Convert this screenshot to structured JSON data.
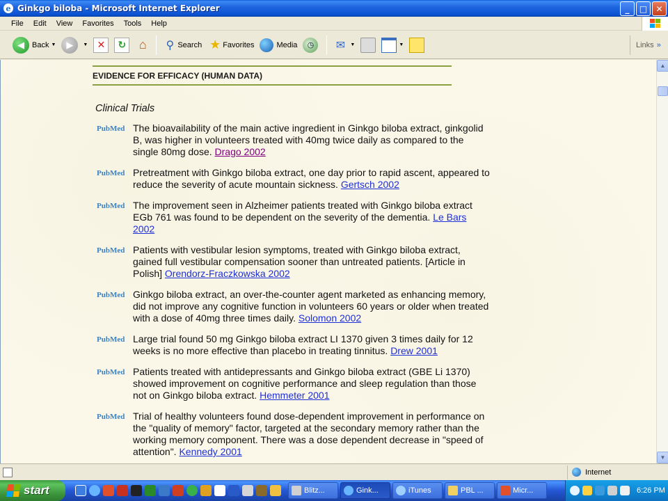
{
  "window": {
    "title": "Ginkgo biloba - Microsoft Internet Explorer",
    "buttons": {
      "minimize": "_",
      "maximize": "□",
      "close": "✕"
    }
  },
  "menu": [
    "File",
    "Edit",
    "View",
    "Favorites",
    "Tools",
    "Help"
  ],
  "toolbar": {
    "back_label": "Back",
    "search_label": "Search",
    "favorites_label": "Favorites",
    "media_label": "Media",
    "links_label": "Links"
  },
  "page": {
    "heading": "EVIDENCE FOR EFFICACY (HUMAN DATA)",
    "subheading": "Clinical Trials",
    "badge": "PubMed",
    "entries": [
      {
        "text": "The bioavailability of the main active ingredient in Ginkgo biloba extract, ginkgolid B, was higher in volunteers treated with 40mg twice daily as compared to the single 80mg dose. ",
        "link": "Drago 2002"
      },
      {
        "text": "Pretreatment with Ginkgo biloba extract, one day prior to rapid ascent, appeared to reduce the severity of acute mountain sickness. ",
        "link": "Gertsch 2002"
      },
      {
        "text": "The improvement seen in Alzheimer patients treated with Ginkgo biloba extract EGb 761 was found to be dependent on the severity of the dementia. ",
        "link": "Le Bars 2002"
      },
      {
        "text": "Patients with vestibular lesion symptoms, treated with Ginkgo biloba extract, gained full vestibular compensation sooner than untreated patients. [Article in Polish] ",
        "link": "Orendorz-Fraczkowska 2002"
      },
      {
        "text": "Ginkgo biloba extract, an over-the-counter agent marketed as enhancing memory, did not improve any cognitive function in volunteers 60 years or older when treated with a dose of 40mg three times daily. ",
        "link": "Solomon 2002"
      },
      {
        "text": "Large trial found 50 mg Ginkgo biloba extract LI 1370 given 3 times daily for 12 weeks is no more effective than placebo in treating tinnitus. ",
        "link": "Drew 2001"
      },
      {
        "text": "Patients treated with antidepressants and Ginkgo biloba extract (GBE Li 1370) showed improvement on cognitive performance and sleep regulation than those not on Ginkgo biloba extract. ",
        "link": "Hemmeter 2001"
      },
      {
        "text": "Trial of healthy volunteers found dose-dependent improvement in performance on the \"quality of memory\" factor, targeted at the secondary memory rather than the working memory component. There was a dose dependent decrease in \"speed of attention\". ",
        "link": "Kennedy 2001"
      }
    ]
  },
  "status": {
    "zone": "Internet"
  },
  "taskbar": {
    "start_label": "start",
    "tasks": [
      "Blitz...",
      "Gink...",
      "iTunes",
      "PBL ...",
      "Micr..."
    ],
    "clock": "6:26 PM"
  }
}
